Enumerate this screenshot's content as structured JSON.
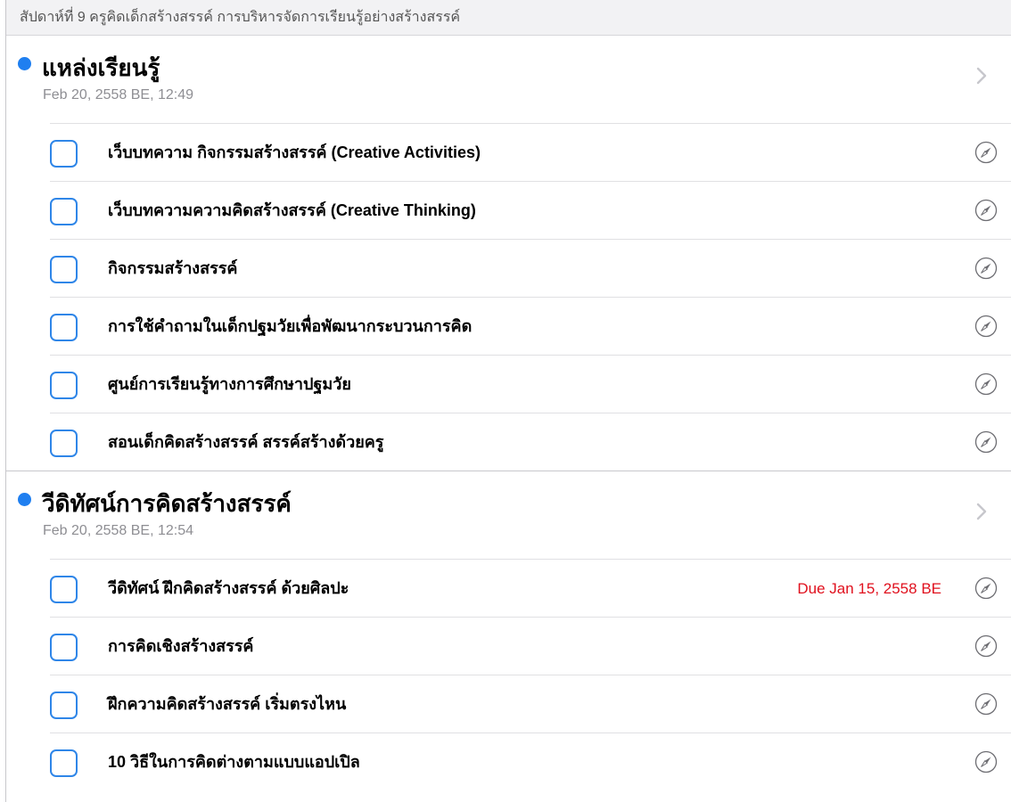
{
  "header": {
    "text": "สัปดาห์ที่ 9 ครูคิดเด็กสร้างสรรค์ การบริหารจัดการเรียนรู้อย่างสร้างสรรค์"
  },
  "colors": {
    "accent": "#1f7ff0",
    "checkbox_border": "#2f86e8",
    "due_red": "#e0101d",
    "secondary_text": "#8e8e93"
  },
  "icons": {
    "disclosure": "chevron-right-icon",
    "link": "safari-compass-icon",
    "list_marker": "blue-dot-icon"
  },
  "sections": [
    {
      "title": "แหล่งเรียนรู้",
      "date": "Feb 20, 2558 BE, 12:49",
      "items": [
        {
          "label": "เว็บบทความ กิจกรรมสร้างสรรค์ (Creative Activities)",
          "due": ""
        },
        {
          "label": "เว็บบทความความคิดสร้างสรรค์ (Creative Thinking)",
          "due": ""
        },
        {
          "label": "กิจกรรมสร้างสรรค์",
          "due": ""
        },
        {
          "label": "การใช้คำถามในเด็กปฐมวัยเพื่อพัฒนากระบวนการคิด",
          "due": ""
        },
        {
          "label": "ศูนย์การเรียนรู้ทางการศึกษาปฐมวัย",
          "due": ""
        },
        {
          "label": "สอนเด็กคิดสร้างสรรค์ สรรค์สร้างด้วยครู",
          "due": ""
        }
      ]
    },
    {
      "title": "วีดิทัศน์การคิดสร้างสรรค์",
      "date": "Feb 20, 2558 BE, 12:54",
      "items": [
        {
          "label": "วีดิทัศน์ ฝึกคิดสร้างสรรค์ ด้วยศิลปะ",
          "due": "Due Jan 15, 2558 BE"
        },
        {
          "label": "การคิดเชิงสร้างสรรค์",
          "due": ""
        },
        {
          "label": "ฝึกความคิดสร้างสรรค์ เริ่มตรงไหน",
          "due": ""
        },
        {
          "label": "10 วิธีในการคิดต่างตามแบบแอปเปิล",
          "due": ""
        }
      ]
    }
  ]
}
